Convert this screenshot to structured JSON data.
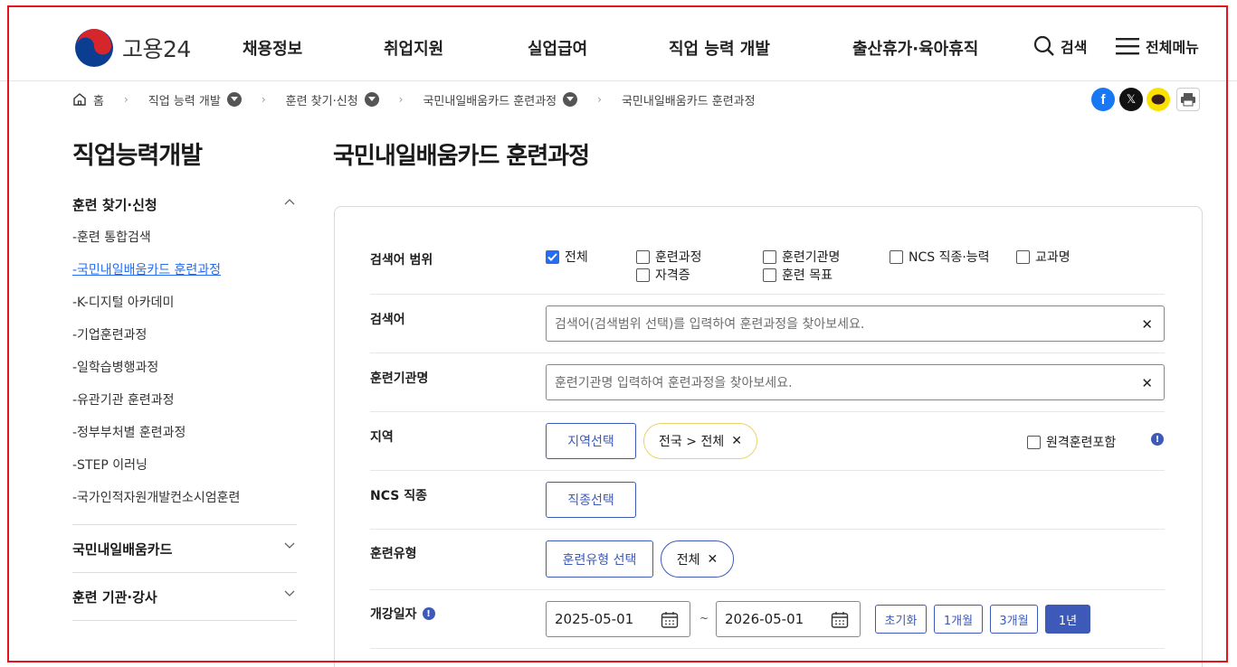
{
  "header": {
    "logo_text": "고용24",
    "gnb": [
      "채용정보",
      "취업지원",
      "실업급여",
      "직업 능력 개발",
      "출산휴가·육아휴직"
    ],
    "search_label": "검색",
    "menu_label": "전체메뉴"
  },
  "breadcrumb": {
    "home": "홈",
    "items": [
      "직업 능력 개발",
      "훈련 찾기·신청",
      "국민내일배움카드 훈련과정",
      "국민내일배움카드 훈련과정"
    ]
  },
  "sidebar": {
    "title": "직업능력개발",
    "section1": "훈련 찾기·신청",
    "items": [
      "-훈련 통합검색",
      "-국민내일배움카드 훈련과정",
      "-K-디지털 아카데미",
      "-기업훈련과정",
      "-일학습병행과정",
      "-유관기관 훈련과정",
      "-정부부처별 훈련과정",
      "-STEP 이러닝",
      "-국가인적자원개발컨소시엄훈련"
    ],
    "section2": "국민내일배움카드",
    "section3": "훈련 기관·강사"
  },
  "main": {
    "title": "국민내일배움카드 훈련과정",
    "scope": {
      "label": "검색어 범위",
      "options": [
        {
          "label": "전체",
          "checked": true
        },
        {
          "label": "훈련과정",
          "checked": false
        },
        {
          "label": "훈련기관명",
          "checked": false
        },
        {
          "label": "NCS 직종·능력",
          "checked": false
        },
        {
          "label": "교과명",
          "checked": false
        },
        {
          "label": "자격증",
          "checked": false
        },
        {
          "label": "훈련 목표",
          "checked": false
        }
      ]
    },
    "keyword": {
      "label": "검색어",
      "placeholder": "검색어(검색범위 선택)를 입력하여 훈련과정을 찾아보세요."
    },
    "institution": {
      "label": "훈련기관명",
      "placeholder": "훈련기관명 입력하여 훈련과정을 찾아보세요."
    },
    "region": {
      "label": "지역",
      "button": "지역선택",
      "chip": "전국 > 전체",
      "remote_label": "원격훈련포함"
    },
    "ncs": {
      "label": "NCS 직종",
      "button": "직종선택"
    },
    "type": {
      "label": "훈련유형",
      "button": "훈련유형 선택",
      "chip": "전체"
    },
    "date": {
      "label": "개강일자",
      "start": "2025-05-01",
      "tilde": "~",
      "end": "2026-05-01",
      "presets": [
        "초기화",
        "1개월",
        "3개월",
        "1년"
      ],
      "active_preset": "1년"
    }
  },
  "colors": {
    "primary": "#3d5ab8",
    "link": "#256ef4",
    "chip_border": "#e6d36a",
    "frame": "#e3141b"
  }
}
